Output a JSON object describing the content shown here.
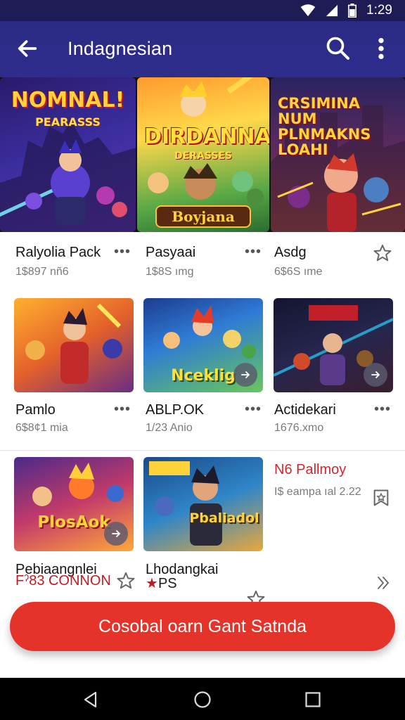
{
  "status_bar": {
    "time": "1:29"
  },
  "app_bar": {
    "title": "Indagnesian",
    "icons": [
      "back-arrow-icon",
      "search-icon",
      "more-vert-icon"
    ]
  },
  "hero": {
    "banners": [
      {
        "title": "NOMNAL!",
        "subtitle": "PEARASSS"
      },
      {
        "title": "DIRDANNAN",
        "subtitle": "DERASSES",
        "badge": "Boyjana"
      },
      {
        "title": "CRSIMINA NUM PLNMAKNS LOAHI"
      }
    ]
  },
  "row1": [
    {
      "name": "Ralyolia Pack",
      "meta": "1$897 nñ6"
    },
    {
      "name": "Pasyaai",
      "meta": "1$8S ımg"
    },
    {
      "name": "Asdg",
      "meta": "6$6S ıme"
    }
  ],
  "row2": [
    {
      "name": "Pamlo",
      "meta": "6$8¢1 mia"
    },
    {
      "name": "ABLP.OK",
      "meta": "1/23 Anio",
      "image_title": "Nceklig"
    },
    {
      "name": "Actidekari",
      "meta": "1676.xmo"
    }
  ],
  "row3": {
    "tiles": [
      {
        "name": "Pebiaangnlei",
        "meta": "Fˀ83 CONNON",
        "image_title": "PlosAok"
      },
      {
        "name": "Lhodangkai",
        "meta": "PS",
        "image_title": "Pbaliadol"
      }
    ],
    "side_item": {
      "title": "N6 Pallmoy",
      "meta": "I$ eampa ıal 2.22"
    }
  },
  "cta": {
    "label": "Cosobal oarn Gant Satnda"
  },
  "colors": {
    "primary": "#2f2d8c",
    "accent": "#e5332a",
    "status_bar": "#1f1b55"
  }
}
